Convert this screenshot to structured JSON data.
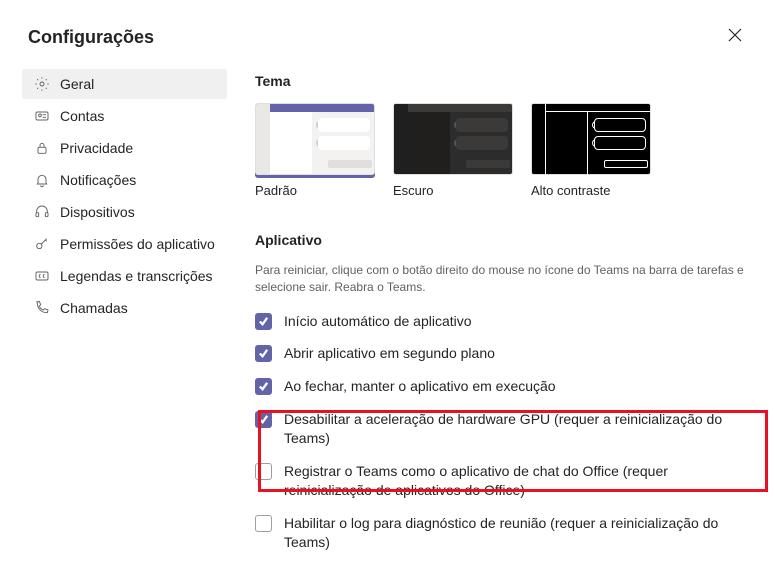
{
  "title": "Configurações",
  "sidebar": {
    "items": [
      {
        "label": "Geral"
      },
      {
        "label": "Contas"
      },
      {
        "label": "Privacidade"
      },
      {
        "label": "Notificações"
      },
      {
        "label": "Dispositivos"
      },
      {
        "label": "Permissões do aplicativo"
      },
      {
        "label": "Legendas e transcrições"
      },
      {
        "label": "Chamadas"
      }
    ]
  },
  "theme": {
    "heading": "Tema",
    "options": [
      {
        "label": "Padrão"
      },
      {
        "label": "Escuro"
      },
      {
        "label": "Alto contraste"
      }
    ]
  },
  "app": {
    "heading": "Aplicativo",
    "hint": "Para reiniciar, clique com o botão direito do mouse no ícone do Teams na barra de tarefas e selecione sair. Reabra o Teams.",
    "options": [
      {
        "checked": true,
        "label": "Início automático de aplicativo"
      },
      {
        "checked": true,
        "label": "Abrir aplicativo em segundo plano"
      },
      {
        "checked": true,
        "label": "Ao fechar, manter o aplicativo em execução"
      },
      {
        "checked": true,
        "label": "Desabilitar a aceleração de hardware GPU (requer a reinicialização do Teams)"
      },
      {
        "checked": false,
        "label": "Registrar o Teams como o aplicativo de chat do Office (requer reinicialização de aplicativos do Office)"
      },
      {
        "checked": false,
        "label": "Habilitar o log para diagnóstico de reunião (requer a reinicialização do Teams)"
      }
    ]
  }
}
